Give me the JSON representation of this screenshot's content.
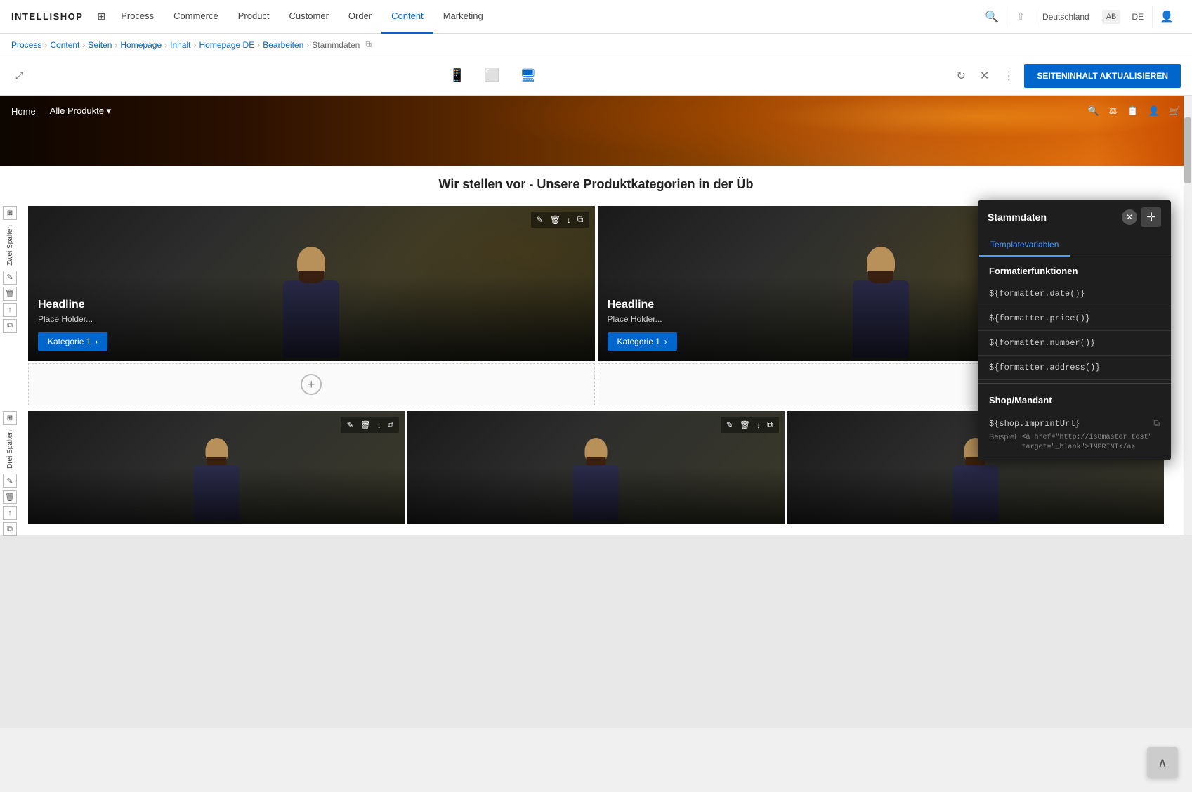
{
  "app": {
    "logo": "INTELLISHOP"
  },
  "nav": {
    "items": [
      {
        "label": "Process",
        "active": false
      },
      {
        "label": "Commerce",
        "active": false
      },
      {
        "label": "Product",
        "active": false
      },
      {
        "label": "Customer",
        "active": false
      },
      {
        "label": "Order",
        "active": false
      },
      {
        "label": "Content",
        "active": true
      },
      {
        "label": "Marketing",
        "active": false
      }
    ],
    "language": "Deutschland",
    "lang_code": "DE"
  },
  "breadcrumb": {
    "items": [
      "Process",
      "Content",
      "Seiten",
      "Homepage",
      "Inhalt",
      "Homepage DE",
      "Bearbeiten",
      "Stammdaten"
    ]
  },
  "toolbar": {
    "update_btn": "SEITENINHALT AKTUALISIEREN"
  },
  "preview": {
    "hero_nav": [
      "Home",
      "Alle Produkte"
    ],
    "section_title": "Wir stellen vor - Unsere Produktkategorien in der Üb",
    "two_col_label": "Zwei Spalten",
    "three_col_label": "Drei Spalten",
    "cards": [
      {
        "headline": "Headline",
        "placeholder": "Place Holder...",
        "btn": "Kategorie 1"
      },
      {
        "headline": "Headline",
        "placeholder": "Place Holder...",
        "btn": "Kategorie 1"
      }
    ]
  },
  "panel": {
    "title": "Stammdaten",
    "tabs": [
      "Templatevariablen"
    ],
    "sections": [
      {
        "name": "Formatierfunktionen",
        "items": [
          "${formatter.date()}",
          "${formatter.price()}",
          "${formatter.number()}",
          "${formatter.address()}"
        ]
      },
      {
        "name": "Shop/Mandant",
        "items": [
          {
            "key": "${shop.imprintUrl}",
            "example_label": "Beispiel",
            "example_code": "<a href=\"http://is8master.test\" target=\"_blank\">IMPRINT</a>"
          }
        ]
      }
    ]
  }
}
